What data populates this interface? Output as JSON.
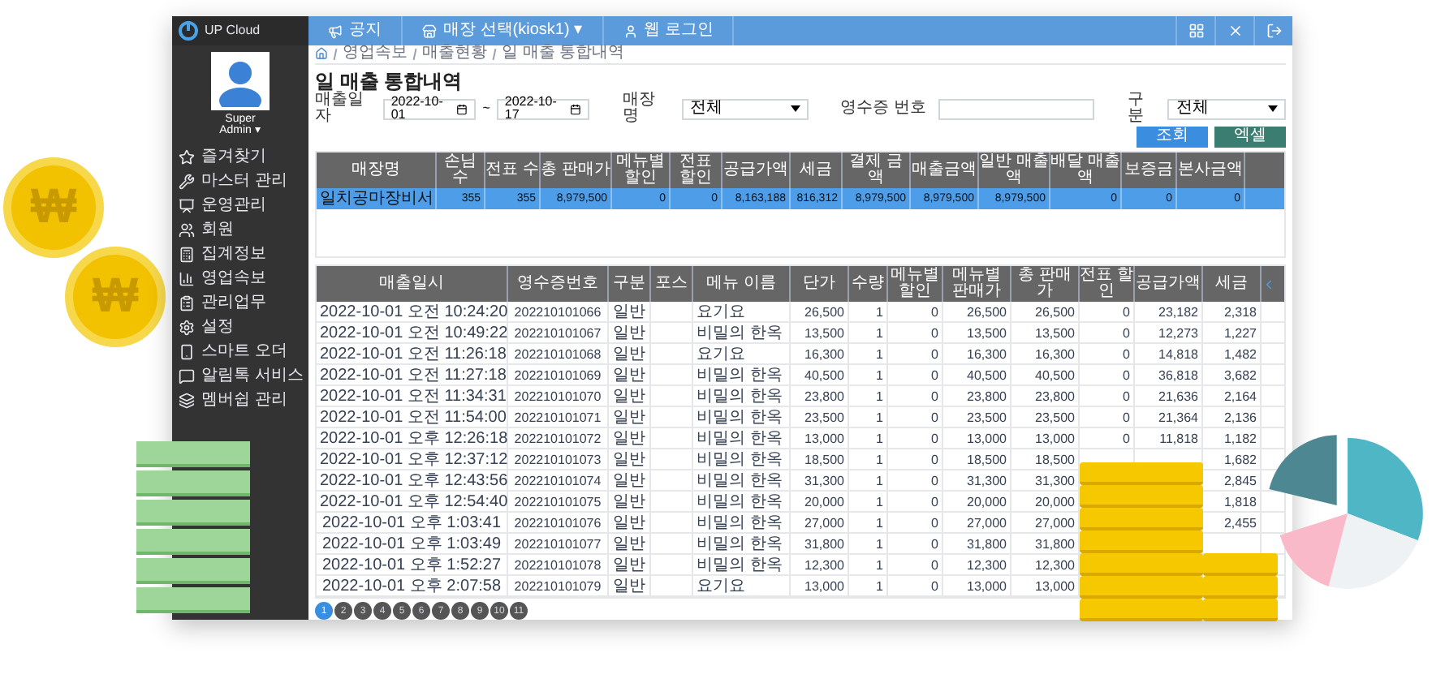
{
  "topbar": {
    "brand": "UP Cloud",
    "items": [
      "공지",
      "매장 선택(kiosk1) ▾",
      "웹 로그인"
    ]
  },
  "profile": {
    "name": "Super",
    "role": "Admin ▾"
  },
  "sidebar": {
    "items": [
      "즐겨찾기",
      "마스터 관리",
      "운영관리",
      "회원",
      "집계정보",
      "영업속보",
      "관리업무",
      "설정",
      "스마트 오더",
      "알림톡 서비스",
      "멤버쉽 관리"
    ]
  },
  "breadcrumb": [
    "영업속보",
    "매출현황",
    "일 매출 통합내역"
  ],
  "title": "일 매출 통합내역",
  "filters": {
    "date_label": "매출일자",
    "date_from": "2022-10-01",
    "date_sep": "~",
    "date_to": "2022-10-17",
    "store_label": "매장명",
    "store_value": "전체",
    "receipt_label": "영수증 번호",
    "type_label": "구분",
    "type_value": "전체"
  },
  "buttons": [
    "조회",
    "엑셀"
  ],
  "summary_table": {
    "columns": [
      "매장명",
      "손님수",
      "전표 수",
      "총 판매가",
      "메뉴별 할인",
      "전표 할인",
      "공급가액",
      "세금",
      "결제 금액",
      "매출금액",
      "일반 매출액",
      "배달 매출액",
      "보증금",
      "본사금액"
    ],
    "rows": [
      {
        "selected": true,
        "cells": [
          "일치공마장비서",
          "355",
          "355",
          "8,979,500",
          "0",
          "0",
          "8,163,188",
          "816,312",
          "8,979,500",
          "8,979,500",
          "8,979,500",
          "0",
          "0",
          "0"
        ]
      }
    ]
  },
  "detail_table": {
    "columns": [
      "매출일시",
      "영수증번호",
      "구분",
      "포스",
      "메뉴 이름",
      "단가",
      "수량",
      "메뉴별 할인",
      "메뉴별 판매가",
      "총 판매가",
      "전표 할인",
      "공급가액",
      "세금"
    ],
    "rows": [
      [
        "2022-10-01 오전 10:24:20",
        "202210101066",
        "일반",
        "",
        "요기요",
        "26,500",
        "1",
        "0",
        "26,500",
        "26,500",
        "0",
        "23,182",
        "2,318"
      ],
      [
        "2022-10-01 오전 10:49:22",
        "202210101067",
        "일반",
        "",
        "비밀의 한옥",
        "13,500",
        "1",
        "0",
        "13,500",
        "13,500",
        "0",
        "12,273",
        "1,227"
      ],
      [
        "2022-10-01 오전 11:26:18",
        "202210101068",
        "일반",
        "",
        "요기요",
        "16,300",
        "1",
        "0",
        "16,300",
        "16,300",
        "0",
        "14,818",
        "1,482"
      ],
      [
        "2022-10-01 오전 11:27:18",
        "202210101069",
        "일반",
        "",
        "비밀의 한옥",
        "40,500",
        "1",
        "0",
        "40,500",
        "40,500",
        "0",
        "36,818",
        "3,682"
      ],
      [
        "2022-10-01 오전 11:34:31",
        "202210101070",
        "일반",
        "",
        "비밀의 한옥",
        "23,800",
        "1",
        "0",
        "23,800",
        "23,800",
        "0",
        "21,636",
        "2,164"
      ],
      [
        "2022-10-01 오전 11:54:00",
        "202210101071",
        "일반",
        "",
        "비밀의 한옥",
        "23,500",
        "1",
        "0",
        "23,500",
        "23,500",
        "0",
        "21,364",
        "2,136"
      ],
      [
        "2022-10-01 오후 12:26:18",
        "202210101072",
        "일반",
        "",
        "비밀의 한옥",
        "13,000",
        "1",
        "0",
        "13,000",
        "13,000",
        "0",
        "11,818",
        "1,182"
      ],
      [
        "2022-10-01 오후 12:37:12",
        "202210101073",
        "일반",
        "",
        "비밀의 한옥",
        "18,500",
        "1",
        "0",
        "18,500",
        "18,500",
        null,
        null,
        "1,682"
      ],
      [
        "2022-10-01 오후 12:43:56",
        "202210101074",
        "일반",
        "",
        "비밀의 한옥",
        "31,300",
        "1",
        "0",
        "31,300",
        "31,300",
        null,
        null,
        "2,845"
      ],
      [
        "2022-10-01 오후 12:54:40",
        "202210101075",
        "일반",
        "",
        "비밀의 한옥",
        "20,000",
        "1",
        "0",
        "20,000",
        "20,000",
        null,
        null,
        "1,818"
      ],
      [
        "2022-10-01 오후 1:03:41",
        "202210101076",
        "일반",
        "",
        "비밀의 한옥",
        "27,000",
        "1",
        "0",
        "27,000",
        "27,000",
        null,
        null,
        "2,455"
      ],
      [
        "2022-10-01 오후 1:03:49",
        "202210101077",
        "일반",
        "",
        "비밀의 한옥",
        "31,800",
        "1",
        "0",
        "31,800",
        "31,800",
        null,
        null,
        null
      ],
      [
        "2022-10-01 오후 1:52:27",
        "202210101078",
        "일반",
        "",
        "비밀의 한옥",
        "12,300",
        "1",
        "0",
        "12,300",
        "12,300",
        null,
        null,
        null
      ],
      [
        "2022-10-01 오후 2:07:58",
        "202210101079",
        "일반",
        "",
        "요기요",
        "13,000",
        "1",
        "0",
        "13,000",
        "13,000",
        null,
        null,
        null
      ]
    ]
  },
  "pages": [
    {
      "label": "1",
      "selected": true
    },
    {
      "label": "2",
      "selected": false
    },
    {
      "label": "3",
      "selected": false
    },
    {
      "label": "4",
      "selected": false
    },
    {
      "label": "5",
      "selected": false
    },
    {
      "label": "6",
      "selected": false
    },
    {
      "label": "7",
      "selected": false
    },
    {
      "label": "8",
      "selected": false
    },
    {
      "label": "9",
      "selected": false
    },
    {
      "label": "10",
      "selected": false
    },
    {
      "label": "11",
      "selected": false
    }
  ],
  "coins": [
    {
      "symbol": "₩"
    },
    {
      "symbol": "₩"
    }
  ]
}
